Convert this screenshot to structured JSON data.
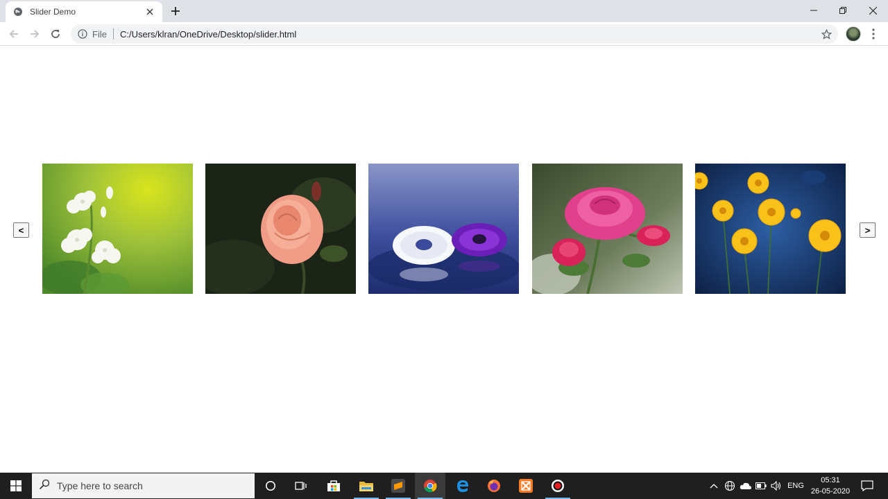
{
  "browser": {
    "tab_title": "Slider Demo",
    "scheme_label": "File",
    "url": "C:/Users/klran/OneDrive/Desktop/slider.html"
  },
  "slider": {
    "prev_label": "<",
    "next_label": ">",
    "slides": [
      {
        "subject": "white jasmine flowers"
      },
      {
        "subject": "peach rose"
      },
      {
        "subject": "white and purple daisies"
      },
      {
        "subject": "pink roses"
      },
      {
        "subject": "yellow daisies"
      }
    ]
  },
  "taskbar": {
    "search_placeholder": "Type here to search",
    "language": "ENG",
    "time": "05:31",
    "date": "26-05-2020",
    "apps": [
      "cortana-icon",
      "task-view-icon",
      "store-icon",
      "file-explorer-icon",
      "sublime-text-icon",
      "chrome-icon",
      "edge-icon",
      "firefox-icon",
      "xampp-icon",
      "recorder-icon"
    ]
  },
  "colors": {
    "tabstrip": "#dee1e6",
    "omnibox": "#f1f3f4",
    "taskbar": "#1f1f1f",
    "active_underline": "#76b9ed"
  }
}
